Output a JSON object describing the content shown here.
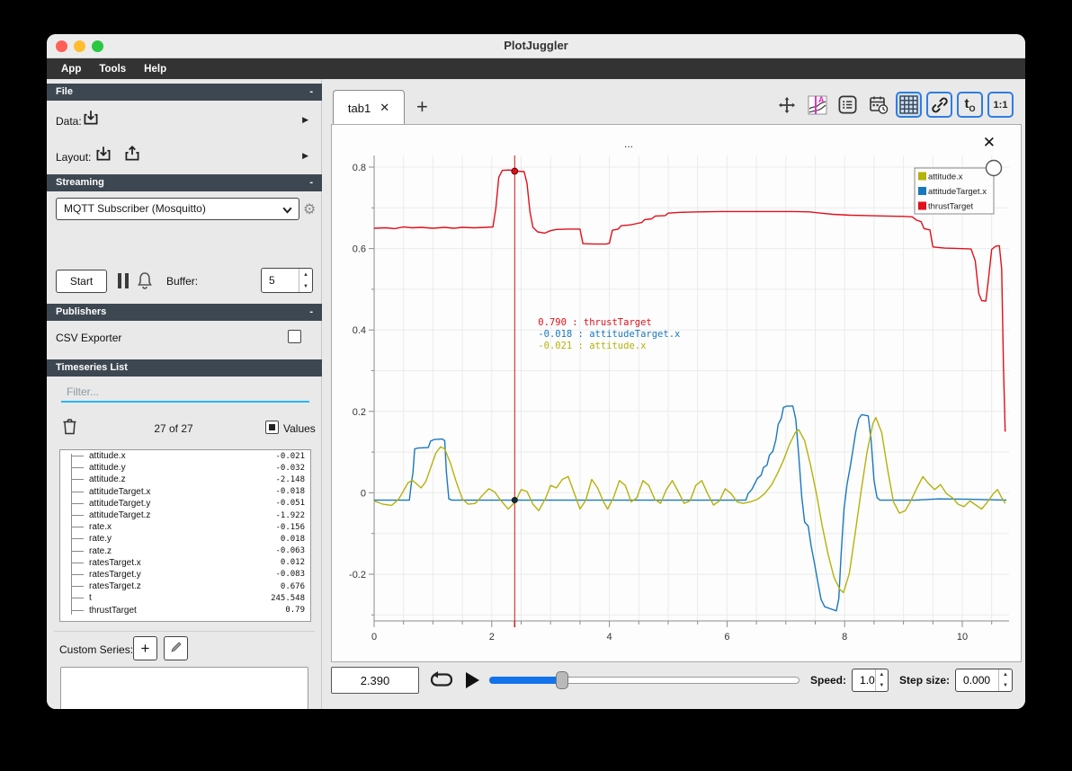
{
  "window": {
    "title": "PlotJuggler"
  },
  "menu": {
    "items": [
      "App",
      "Tools",
      "Help"
    ]
  },
  "sidebar": {
    "file": {
      "title": "File",
      "collapse": "-",
      "data_label": "Data:",
      "layout_label": "Layout:"
    },
    "streaming": {
      "title": "Streaming",
      "collapse": "-",
      "source_value": "MQTT Subscriber (Mosquitto)",
      "start_label": "Start",
      "buffer_label": "Buffer:",
      "buffer_value": "5"
    },
    "publishers": {
      "title": "Publishers",
      "collapse": "-",
      "csv_label": "CSV Exporter",
      "csv_checked": false
    },
    "timeseries": {
      "title": "Timeseries List",
      "filter_placeholder": "Filter...",
      "count_label": "27 of 27",
      "values_label": "Values",
      "values_checked": true,
      "items": [
        {
          "name": "attitude.x",
          "value": "-0.021"
        },
        {
          "name": "attitude.y",
          "value": "-0.032"
        },
        {
          "name": "attitude.z",
          "value": "-2.148"
        },
        {
          "name": "attitudeTarget.x",
          "value": "-0.018"
        },
        {
          "name": "attitudeTarget.y",
          "value": "-0.051"
        },
        {
          "name": "attitudeTarget.z",
          "value": "-1.922"
        },
        {
          "name": "rate.x",
          "value": "-0.156"
        },
        {
          "name": "rate.y",
          "value": "0.018"
        },
        {
          "name": "rate.z",
          "value": "-0.063"
        },
        {
          "name": "ratesTarget.x",
          "value": "0.012"
        },
        {
          "name": "ratesTarget.y",
          "value": "-0.083"
        },
        {
          "name": "ratesTarget.z",
          "value": "0.676"
        },
        {
          "name": "t",
          "value": "245.548"
        },
        {
          "name": "thrustTarget",
          "value": "0.79"
        }
      ]
    },
    "custom_series": {
      "label": "Custom Series:"
    }
  },
  "tabbar": {
    "tab_label": "tab1",
    "add_label": "+"
  },
  "toolbar_icons": [
    {
      "name": "pan-zoom-icon",
      "active": false
    },
    {
      "name": "tracker-style-icon",
      "active": false
    },
    {
      "name": "curve-list-icon",
      "active": false
    },
    {
      "name": "datetime-axis-icon",
      "active": false
    },
    {
      "name": "grid-layout-icon",
      "active": true
    },
    {
      "name": "link-ranges-icon",
      "active": true
    },
    {
      "name": "time-offset-icon",
      "active": true
    },
    {
      "name": "ratio-one-to-one-icon",
      "active": true
    }
  ],
  "plot": {
    "title": "...",
    "legend": [
      {
        "label": "attitude.x",
        "color": "#b4b20c"
      },
      {
        "label": "attitudeTarget.x",
        "color": "#1878be"
      },
      {
        "label": "thrustTarget",
        "color": "#e20f1a"
      }
    ],
    "tracker": {
      "time": 2.39,
      "readouts": [
        {
          "value": " 0.790",
          "label": "thrustTarget",
          "color": "#e20f1a"
        },
        {
          "value": "-0.018",
          "label": "attitudeTarget.x",
          "color": "#1878be"
        },
        {
          "value": "-0.021",
          "label": "attitude.x",
          "color": "#b4b20c"
        }
      ]
    }
  },
  "chart_data": {
    "type": "line",
    "title": "...",
    "xlabel": "",
    "ylabel": "",
    "xlim": [
      0,
      10.79
    ],
    "ylim": [
      -0.315,
      0.829
    ],
    "x_ticks": [
      0,
      2,
      4,
      6,
      8,
      10
    ],
    "x_tick_labels": [
      "0",
      "2",
      "4",
      "6",
      "8",
      "10"
    ],
    "y_ticks": [
      -0.2,
      0,
      0.2,
      0.4,
      0.6,
      0.8
    ],
    "y_tick_labels": [
      "-0.2",
      "0",
      "0.2",
      "0.4",
      "0.6",
      "0.8"
    ],
    "grid": true,
    "legend_position": "top-right",
    "series": [
      {
        "name": "thrustTarget",
        "color": "#e20f1a",
        "points": [
          [
            0,
            0.65
          ],
          [
            0.2,
            0.651
          ],
          [
            0.35,
            0.649
          ],
          [
            0.5,
            0.653
          ],
          [
            0.65,
            0.651
          ],
          [
            0.8,
            0.652
          ],
          [
            1.0,
            0.65
          ],
          [
            1.2,
            0.652
          ],
          [
            1.35,
            0.65
          ],
          [
            1.5,
            0.652
          ],
          [
            1.7,
            0.651
          ],
          [
            1.9,
            0.652
          ],
          [
            2.02,
            0.653
          ],
          [
            2.07,
            0.7
          ],
          [
            2.12,
            0.775
          ],
          [
            2.18,
            0.792
          ],
          [
            2.3,
            0.793
          ],
          [
            2.45,
            0.79
          ],
          [
            2.55,
            0.789
          ],
          [
            2.6,
            0.76
          ],
          [
            2.65,
            0.69
          ],
          [
            2.7,
            0.652
          ],
          [
            2.78,
            0.641
          ],
          [
            2.9,
            0.638
          ],
          [
            3.0,
            0.644
          ],
          [
            3.1,
            0.647
          ],
          [
            3.3,
            0.648
          ],
          [
            3.5,
            0.648
          ],
          [
            3.55,
            0.612
          ],
          [
            3.75,
            0.611
          ],
          [
            3.95,
            0.611
          ],
          [
            4.0,
            0.613
          ],
          [
            4.05,
            0.645
          ],
          [
            4.15,
            0.648
          ],
          [
            4.2,
            0.656
          ],
          [
            4.35,
            0.658
          ],
          [
            4.45,
            0.661
          ],
          [
            4.55,
            0.664
          ],
          [
            4.6,
            0.671
          ],
          [
            4.72,
            0.673
          ],
          [
            4.78,
            0.68
          ],
          [
            4.95,
            0.681
          ],
          [
            5.0,
            0.687
          ],
          [
            5.2,
            0.689
          ],
          [
            5.5,
            0.69
          ],
          [
            5.9,
            0.691
          ],
          [
            6.3,
            0.691
          ],
          [
            6.7,
            0.691
          ],
          [
            7.1,
            0.691
          ],
          [
            7.4,
            0.69
          ],
          [
            7.6,
            0.687
          ],
          [
            7.8,
            0.684
          ],
          [
            8.1,
            0.682
          ],
          [
            8.4,
            0.681
          ],
          [
            8.7,
            0.68
          ],
          [
            9.0,
            0.679
          ],
          [
            9.15,
            0.678
          ],
          [
            9.22,
            0.67
          ],
          [
            9.3,
            0.666
          ],
          [
            9.35,
            0.649
          ],
          [
            9.45,
            0.646
          ],
          [
            9.5,
            0.604
          ],
          [
            9.7,
            0.601
          ],
          [
            9.95,
            0.6
          ],
          [
            10.15,
            0.599
          ],
          [
            10.22,
            0.57
          ],
          [
            10.28,
            0.49
          ],
          [
            10.33,
            0.472
          ],
          [
            10.4,
            0.471
          ],
          [
            10.45,
            0.53
          ],
          [
            10.5,
            0.598
          ],
          [
            10.57,
            0.606
          ],
          [
            10.63,
            0.607
          ],
          [
            10.67,
            0.55
          ],
          [
            10.7,
            0.31
          ],
          [
            10.73,
            0.15
          ]
        ]
      },
      {
        "name": "attitudeTarget.x",
        "color": "#1878be",
        "points": [
          [
            0,
            -0.018
          ],
          [
            0.6,
            -0.018
          ],
          [
            0.63,
            0.02
          ],
          [
            0.66,
            0.05
          ],
          [
            0.69,
            0.108
          ],
          [
            0.75,
            0.11
          ],
          [
            0.92,
            0.111
          ],
          [
            0.96,
            0.127
          ],
          [
            1.02,
            0.131
          ],
          [
            1.16,
            0.132
          ],
          [
            1.2,
            0.128
          ],
          [
            1.23,
            0.05
          ],
          [
            1.27,
            -0.015
          ],
          [
            1.32,
            -0.018
          ],
          [
            2.5,
            -0.018
          ],
          [
            4.0,
            -0.018
          ],
          [
            5.5,
            -0.018
          ],
          [
            6.32,
            -0.018
          ],
          [
            6.36,
            -0.002
          ],
          [
            6.42,
            0.008
          ],
          [
            6.47,
            0.022
          ],
          [
            6.52,
            0.036
          ],
          [
            6.58,
            0.043
          ],
          [
            6.62,
            0.062
          ],
          [
            6.68,
            0.068
          ],
          [
            6.72,
            0.092
          ],
          [
            6.78,
            0.102
          ],
          [
            6.83,
            0.13
          ],
          [
            6.87,
            0.168
          ],
          [
            6.92,
            0.182
          ],
          [
            6.96,
            0.21
          ],
          [
            7.02,
            0.213
          ],
          [
            7.12,
            0.213
          ],
          [
            7.17,
            0.18
          ],
          [
            7.22,
            0.09
          ],
          [
            7.27,
            -0.01
          ],
          [
            7.32,
            -0.072
          ],
          [
            7.38,
            -0.082
          ],
          [
            7.43,
            -0.13
          ],
          [
            7.49,
            -0.175
          ],
          [
            7.55,
            -0.225
          ],
          [
            7.6,
            -0.262
          ],
          [
            7.66,
            -0.28
          ],
          [
            7.76,
            -0.285
          ],
          [
            7.86,
            -0.29
          ],
          [
            7.9,
            -0.26
          ],
          [
            7.94,
            -0.15
          ],
          [
            7.99,
            -0.04
          ],
          [
            8.04,
            0.02
          ],
          [
            8.09,
            0.06
          ],
          [
            8.14,
            0.105
          ],
          [
            8.19,
            0.15
          ],
          [
            8.24,
            0.182
          ],
          [
            8.29,
            0.192
          ],
          [
            8.4,
            0.189
          ],
          [
            8.45,
            0.13
          ],
          [
            8.5,
            0.03
          ],
          [
            8.55,
            -0.012
          ],
          [
            8.6,
            -0.018
          ],
          [
            9.2,
            -0.018
          ],
          [
            9.6,
            -0.015
          ],
          [
            10.1,
            -0.016
          ],
          [
            10.75,
            -0.018
          ]
        ]
      },
      {
        "name": "attitude.x",
        "color": "#b4b20c",
        "points": [
          [
            0,
            -0.02
          ],
          [
            0.15,
            -0.028
          ],
          [
            0.3,
            -0.031
          ],
          [
            0.42,
            -0.015
          ],
          [
            0.5,
            0.005
          ],
          [
            0.58,
            0.025
          ],
          [
            0.65,
            0.031
          ],
          [
            0.72,
            0.022
          ],
          [
            0.8,
            0.012
          ],
          [
            0.88,
            0.028
          ],
          [
            0.97,
            0.065
          ],
          [
            1.05,
            0.098
          ],
          [
            1.13,
            0.113
          ],
          [
            1.2,
            0.108
          ],
          [
            1.3,
            0.072
          ],
          [
            1.4,
            0.025
          ],
          [
            1.5,
            -0.015
          ],
          [
            1.6,
            -0.028
          ],
          [
            1.72,
            -0.026
          ],
          [
            1.85,
            -0.005
          ],
          [
            1.95,
            0.01
          ],
          [
            2.05,
            0.002
          ],
          [
            2.15,
            -0.018
          ],
          [
            2.28,
            -0.04
          ],
          [
            2.4,
            -0.022
          ],
          [
            2.5,
            0.008
          ],
          [
            2.6,
            0.003
          ],
          [
            2.7,
            -0.028
          ],
          [
            2.8,
            -0.044
          ],
          [
            2.92,
            -0.012
          ],
          [
            3.0,
            0.018
          ],
          [
            3.1,
            0.012
          ],
          [
            3.2,
            0.033
          ],
          [
            3.3,
            0.04
          ],
          [
            3.42,
            -0.008
          ],
          [
            3.5,
            -0.04
          ],
          [
            3.6,
            -0.018
          ],
          [
            3.7,
            0.033
          ],
          [
            3.8,
            0.012
          ],
          [
            3.9,
            -0.022
          ],
          [
            3.97,
            -0.04
          ],
          [
            4.07,
            -0.012
          ],
          [
            4.17,
            0.03
          ],
          [
            4.27,
            0.018
          ],
          [
            4.37,
            -0.022
          ],
          [
            4.47,
            -0.012
          ],
          [
            4.57,
            0.03
          ],
          [
            4.67,
            0.018
          ],
          [
            4.77,
            -0.016
          ],
          [
            4.87,
            -0.026
          ],
          [
            4.97,
            0.008
          ],
          [
            5.07,
            0.03
          ],
          [
            5.17,
            0.003
          ],
          [
            5.27,
            -0.026
          ],
          [
            5.37,
            -0.02
          ],
          [
            5.47,
            0.018
          ],
          [
            5.57,
            0.03
          ],
          [
            5.67,
            -0.002
          ],
          [
            5.77,
            -0.03
          ],
          [
            5.87,
            -0.02
          ],
          [
            5.97,
            0.01
          ],
          [
            6.07,
            -0.002
          ],
          [
            6.17,
            -0.022
          ],
          [
            6.27,
            -0.026
          ],
          [
            6.4,
            -0.022
          ],
          [
            6.52,
            -0.016
          ],
          [
            6.64,
            -0.002
          ],
          [
            6.76,
            0.02
          ],
          [
            6.86,
            0.048
          ],
          [
            6.96,
            0.08
          ],
          [
            7.06,
            0.118
          ],
          [
            7.16,
            0.148
          ],
          [
            7.22,
            0.155
          ],
          [
            7.32,
            0.128
          ],
          [
            7.42,
            0.068
          ],
          [
            7.52,
            -0.002
          ],
          [
            7.62,
            -0.082
          ],
          [
            7.72,
            -0.152
          ],
          [
            7.82,
            -0.208
          ],
          [
            7.92,
            -0.238
          ],
          [
            7.98,
            -0.245
          ],
          [
            8.08,
            -0.198
          ],
          [
            8.18,
            -0.098
          ],
          [
            8.28,
            0.004
          ],
          [
            8.38,
            0.1
          ],
          [
            8.48,
            0.17
          ],
          [
            8.53,
            0.185
          ],
          [
            8.63,
            0.148
          ],
          [
            8.73,
            0.058
          ],
          [
            8.83,
            -0.022
          ],
          [
            8.93,
            -0.05
          ],
          [
            9.03,
            -0.044
          ],
          [
            9.13,
            -0.018
          ],
          [
            9.23,
            0.012
          ],
          [
            9.33,
            0.04
          ],
          [
            9.43,
            0.022
          ],
          [
            9.53,
            0.008
          ],
          [
            9.63,
            0.02
          ],
          [
            9.73,
            -0.002
          ],
          [
            9.83,
            -0.012
          ],
          [
            9.93,
            -0.028
          ],
          [
            10.03,
            -0.034
          ],
          [
            10.13,
            -0.02
          ],
          [
            10.23,
            -0.03
          ],
          [
            10.33,
            -0.04
          ],
          [
            10.43,
            -0.022
          ],
          [
            10.53,
            -0.002
          ],
          [
            10.6,
            0.008
          ],
          [
            10.67,
            -0.012
          ],
          [
            10.73,
            -0.026
          ]
        ]
      }
    ]
  },
  "transport": {
    "time_value": "2.390",
    "slider_fraction": 0.235,
    "speed_label": "Speed:",
    "speed_value": "1.0",
    "step_label": "Step size:",
    "step_value": "0.000"
  }
}
